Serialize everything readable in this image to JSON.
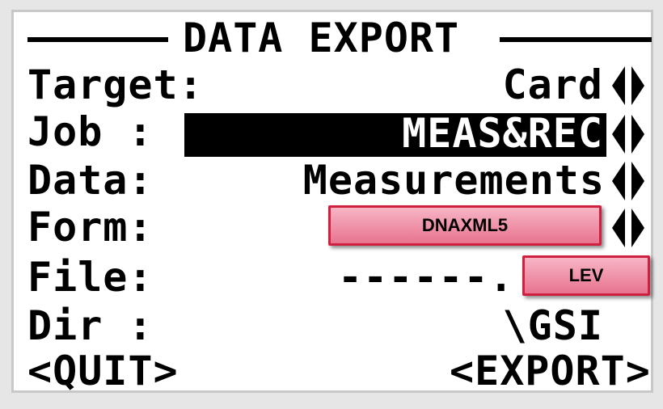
{
  "screen": {
    "title": "DATA EXPORT",
    "rows": [
      {
        "label": "Target:",
        "value": "Card"
      },
      {
        "label": "Job :",
        "value": "MEAS&REC"
      },
      {
        "label": "Data:",
        "value": "Measurements"
      },
      {
        "label": "Form:",
        "value": ""
      },
      {
        "label": "File:",
        "value": "------."
      },
      {
        "label": "Dir :",
        "value": "\\GSI"
      }
    ],
    "buttons": {
      "quit": "<QUIT>",
      "export": "<EXPORT>"
    }
  },
  "callouts": {
    "form_value": "DNAXML5",
    "file_extension": "LEV"
  },
  "colors": {
    "callout_fill": "#e8738f",
    "callout_border": "#d0203f",
    "lcd_ink": "#000000",
    "background": "#ffffff"
  }
}
